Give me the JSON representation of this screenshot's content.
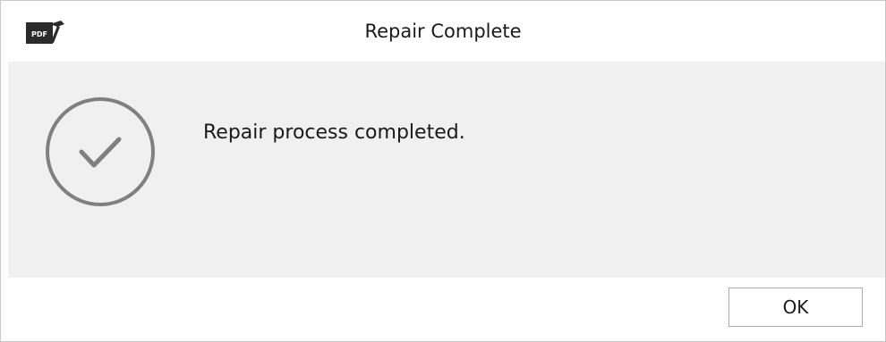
{
  "window": {
    "title": "Repair Complete",
    "app_icon": "pdf-repair-icon",
    "app_icon_text": "PDF"
  },
  "dialog": {
    "status_icon": "check-circle-icon",
    "message": "Repair process completed."
  },
  "footer": {
    "ok_label": "OK"
  },
  "colors": {
    "titlebar_bg": "#ffffff",
    "content_bg": "#f0f0f0",
    "icon_gray": "#808080",
    "button_border": "#adadad"
  }
}
